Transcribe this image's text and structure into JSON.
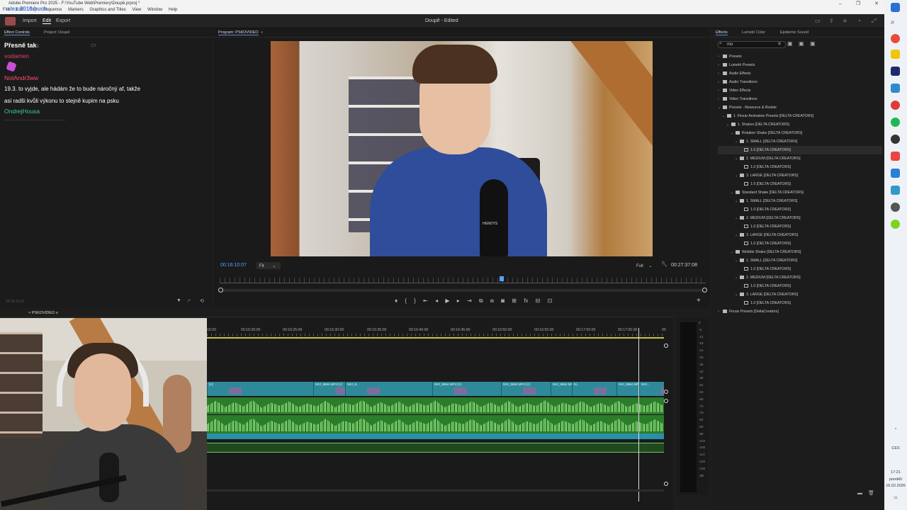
{
  "window": {
    "title": "Adobe Premiere Pro 2025 - F:\\YouTube Web\\Premiery\\Doupě.prproj *",
    "menu": [
      "File",
      "Edit",
      "Clip",
      "Sequence",
      "Markers",
      "Graphics and Titles",
      "View",
      "Window",
      "Help"
    ],
    "overlay_text": "alex 2016 buch",
    "controls": [
      "–",
      "❐",
      "✕"
    ]
  },
  "app_header": {
    "tabs": [
      "Import",
      "Edit",
      "Export"
    ],
    "active_tab": "Edit",
    "center_title": "Doupě - Edited"
  },
  "left_panel": {
    "tabs": [
      "Effect Controls",
      "Project: Doupě"
    ],
    "timecode_bottom": "00:16:10:07"
  },
  "chat": {
    "title": "Přesně tak",
    "title_suffix": "ů",
    "lines": [
      {
        "user": "vodamen",
        "msg": ""
      },
      {
        "user": "",
        "msg": ""
      },
      {
        "user": "NotAndr3ww",
        "msg": "19.3. to vyjde, ale hádám že to bude náročný af, takže asi radši kvůli výkonu to stejně kupim na psku"
      },
      {
        "user": "OndrejHousa",
        "msg": ""
      }
    ]
  },
  "program_monitor": {
    "tab_label": "Program: PSKOVIDEO",
    "timecode_current": "00:16:10:07",
    "zoom": "Fit",
    "quality": "Full",
    "timecode_duration": "00:27:37:08",
    "mic_brand": "HENOYS",
    "transport": [
      "♦",
      "{",
      "}",
      "⇤",
      "◂",
      "▶",
      "▸",
      "⇥",
      "⧉",
      "⧈",
      "◙",
      "⊞",
      "fx",
      "⊟",
      "⊡"
    ]
  },
  "effects_panel": {
    "tabs": [
      "Effects",
      "Lumetri Color",
      "Epidemic Sound"
    ],
    "search_value": "mo",
    "tree": [
      {
        "label": "Presets",
        "level": 0,
        "type": "folder",
        "open": false
      },
      {
        "label": "Lumetri Presets",
        "level": 0,
        "type": "folder",
        "open": false
      },
      {
        "label": "Audio Effects",
        "level": 0,
        "type": "folder",
        "open": false
      },
      {
        "label": "Audio Transitions",
        "level": 0,
        "type": "folder",
        "open": false
      },
      {
        "label": "Video Effects",
        "level": 0,
        "type": "folder",
        "open": false
      },
      {
        "label": "Video Transitions",
        "level": 0,
        "type": "folder",
        "open": false
      },
      {
        "label": "Presets - Resource & Rookie",
        "level": 0,
        "type": "folder",
        "open": true
      },
      {
        "label": "1. Finzar Animation Presets [DELTA CREATORS]",
        "level": 1,
        "type": "folder",
        "open": true
      },
      {
        "label": "1. Shakes [DELTA CREATORS]",
        "level": 2,
        "type": "folder",
        "open": true
      },
      {
        "label": "Rotation Shake [DELTA CREATORS]",
        "level": 3,
        "type": "folder",
        "open": true
      },
      {
        "label": "1. SMALL [DELTA CREATORS]",
        "level": 4,
        "type": "folder",
        "open": true
      },
      {
        "label": "1.0 [DELTA CREATORS]",
        "level": 5,
        "type": "preset",
        "selected": true
      },
      {
        "label": "2. MEDIUM [DELTA CREATORS]",
        "level": 4,
        "type": "folder",
        "open": true
      },
      {
        "label": "1.0 [DELTA CREATORS]",
        "level": 5,
        "type": "preset"
      },
      {
        "label": "3. LARGE [DELTA CREATORS]",
        "level": 4,
        "type": "folder",
        "open": true
      },
      {
        "label": "1.0 [DELTA CREATORS]",
        "level": 5,
        "type": "preset"
      },
      {
        "label": "Standard Shake [DELTA CREATORS]",
        "level": 3,
        "type": "folder",
        "open": true
      },
      {
        "label": "1. SMALL [DELTA CREATORS]",
        "level": 4,
        "type": "folder",
        "open": true
      },
      {
        "label": "1.0 [DELTA CREATORS]",
        "level": 5,
        "type": "preset"
      },
      {
        "label": "2. MEDIUM [DELTA CREATORS]",
        "level": 4,
        "type": "folder",
        "open": true
      },
      {
        "label": "1.0 [DELTA CREATORS]",
        "level": 5,
        "type": "preset"
      },
      {
        "label": "3. LARGE [DELTA CREATORS]",
        "level": 4,
        "type": "folder",
        "open": true
      },
      {
        "label": "1.0 [DELTA CREATORS]",
        "level": 5,
        "type": "preset"
      },
      {
        "label": "Wobble Shake [DELTA CREATORS]",
        "level": 3,
        "type": "folder",
        "open": true
      },
      {
        "label": "1. SMALL [DELTA CREATORS]",
        "level": 4,
        "type": "folder",
        "open": true
      },
      {
        "label": "1.0 [DELTA CREATORS]",
        "level": 5,
        "type": "preset"
      },
      {
        "label": "2. MEDIUM [DELTA CREATORS]",
        "level": 4,
        "type": "folder",
        "open": true
      },
      {
        "label": "1.0 [DELTA CREATORS]",
        "level": 5,
        "type": "preset"
      },
      {
        "label": "3. LARGE [DELTA CREATORS]",
        "level": 4,
        "type": "folder",
        "open": true
      },
      {
        "label": "1.0 [DELTA CREATORS]",
        "level": 5,
        "type": "preset"
      },
      {
        "label": "Finzar Presets [DeltaCreators]",
        "level": 0,
        "type": "folder",
        "open": false
      }
    ]
  },
  "timeline": {
    "sequence_tab": "PSKOVIDEO",
    "ruler_labels": [
      "15:00",
      "00:16:20:00",
      "00:16:25:00",
      "00:16:30:00",
      "00:16:35:00",
      "00:16:40:00",
      "00:16:45:00",
      "00:16:50:00",
      "00:16:55:00",
      "00:17:00:00",
      "00:17:05:00",
      "00"
    ],
    "video_clips": [
      "[V]",
      "MVI_9664.MP4 [V]",
      "MVI_9...",
      "MVI_9664.MP4 [V]",
      "MVI_9664.MP4 [V]",
      "MVI_9664.MP4 [V]",
      "M...",
      "MVI_9664.MP4...",
      "MVI..."
    ]
  },
  "meter": {
    "scale": [
      "0",
      "-6",
      "-12",
      "-18",
      "-24",
      "-30",
      "-36",
      "-42",
      "-48",
      "-54",
      "-60",
      "-66",
      "-72",
      "-78",
      "-84",
      "-90",
      "-96",
      "-102",
      "-108",
      "-114",
      "-120",
      "-126",
      "-dB"
    ]
  },
  "os": {
    "tray": [
      "CES"
    ],
    "time": "17:21",
    "day": "pondělí",
    "date": "16.02.2026"
  }
}
